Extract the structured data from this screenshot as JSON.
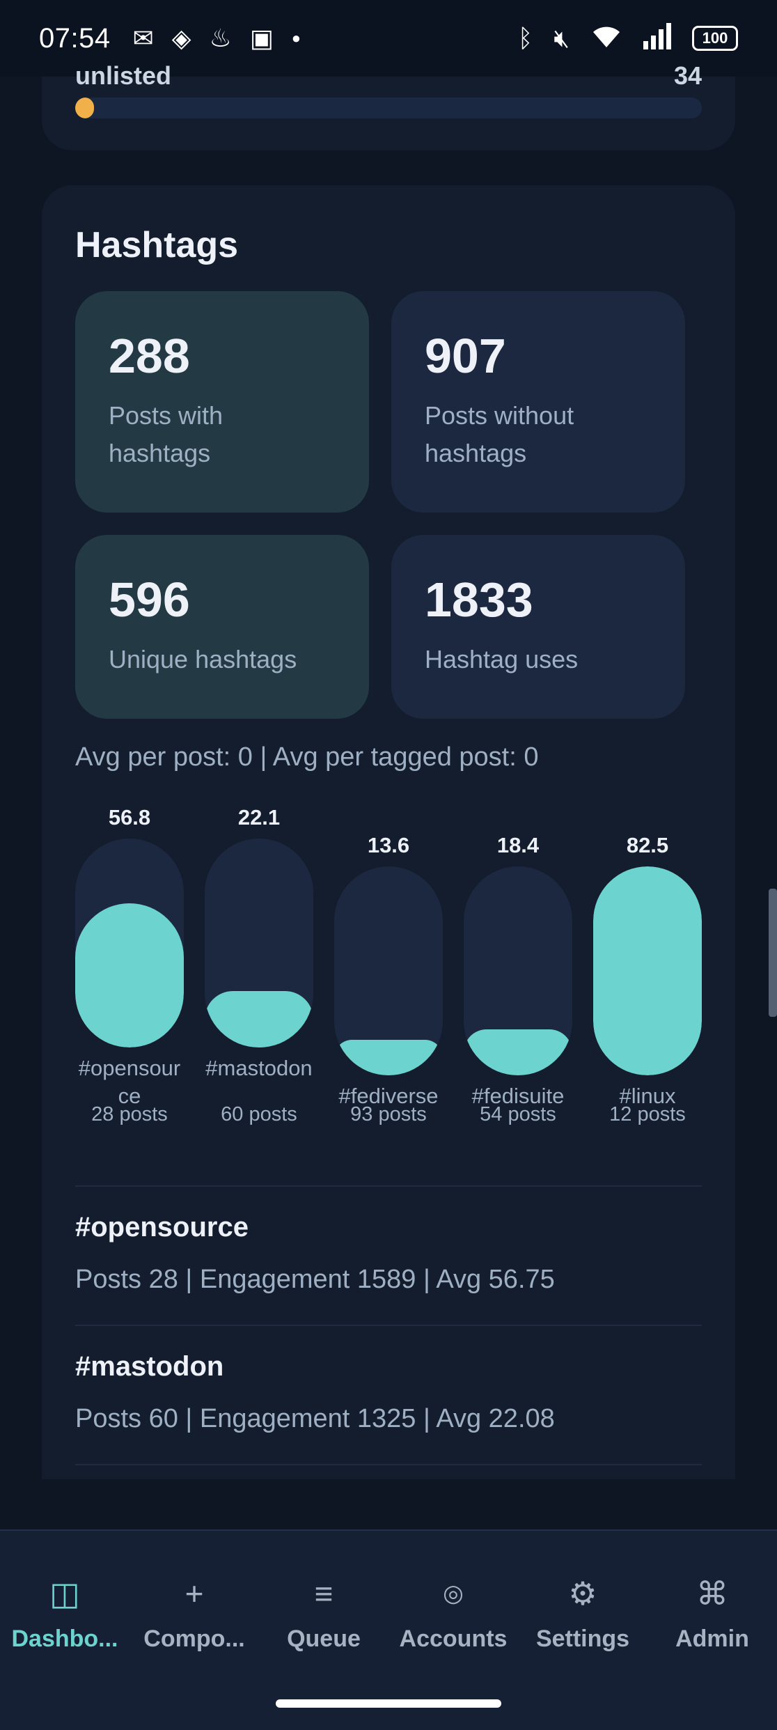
{
  "status_bar": {
    "time": "07:54",
    "left_icons": [
      "mail-icon",
      "diamond-app-icon",
      "fire-app-icon",
      "k-app-icon",
      "dot-icon"
    ],
    "right_icons": [
      "bluetooth-icon",
      "mute-icon",
      "wifi-icon",
      "signal-icon"
    ],
    "battery": "100"
  },
  "prev_card": {
    "label": "unlisted",
    "value": "34",
    "progress_fraction": 0.03,
    "bar_color": "#f2b04a"
  },
  "hashtags": {
    "title": "Hashtags",
    "stats": [
      {
        "value": "288",
        "label": "Posts with hashtags"
      },
      {
        "value": "907",
        "label": "Posts without hashtags"
      },
      {
        "value": "596",
        "label": "Unique hashtags"
      },
      {
        "value": "1833",
        "label": "Hashtag uses"
      }
    ],
    "avg_line": "Avg per post: 0 | Avg per tagged post: 0",
    "bars": [
      {
        "value": "56.8",
        "name": "#opensource",
        "posts": "28 posts",
        "fraction": 0.69
      },
      {
        "value": "22.1",
        "name": "#mastodon",
        "posts": "60 posts",
        "fraction": 0.27
      },
      {
        "value": "13.6",
        "name": "#fediverse",
        "posts": "93 posts",
        "fraction": 0.17
      },
      {
        "value": "18.4",
        "name": "#fedisuite",
        "posts": "54 posts",
        "fraction": 0.22
      },
      {
        "value": "82.5",
        "name": "#linux",
        "posts": "12 posts",
        "fraction": 1.0
      }
    ],
    "accent_color": "#6dd3ce",
    "top_tags": [
      {
        "name": "#opensource",
        "detail": "Posts 28 | Engagement 1589 | Avg 56.75"
      },
      {
        "name": "#mastodon",
        "detail": "Posts 60 | Engagement 1325 | Avg 22.08"
      }
    ]
  },
  "bottom_nav": {
    "items": [
      {
        "label": "Dashbo...",
        "icon": "dashboard-icon",
        "glyph": "◫",
        "active": true
      },
      {
        "label": "Compo...",
        "icon": "plus-icon",
        "glyph": "+",
        "active": false
      },
      {
        "label": "Queue",
        "icon": "list-icon",
        "glyph": "≡",
        "active": false
      },
      {
        "label": "Accounts",
        "icon": "accounts-icon",
        "glyph": "◎",
        "active": false
      },
      {
        "label": "Settings",
        "icon": "gear-icon",
        "glyph": "⚙",
        "active": false
      },
      {
        "label": "Admin",
        "icon": "command-icon",
        "glyph": "⌘",
        "active": false
      }
    ]
  }
}
